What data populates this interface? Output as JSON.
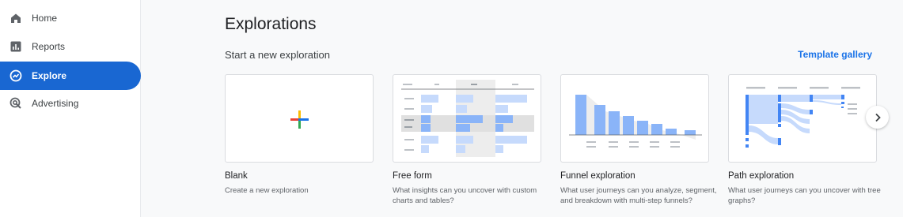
{
  "sidebar": {
    "items": [
      {
        "label": "Home",
        "icon": "home-icon",
        "active": false
      },
      {
        "label": "Reports",
        "icon": "bar-chart-icon",
        "active": false
      },
      {
        "label": "Explore",
        "icon": "explore-icon",
        "active": true
      },
      {
        "label": "Advertising",
        "icon": "advertising-icon",
        "active": false
      }
    ]
  },
  "main": {
    "title": "Explorations",
    "subtitle": "Start a new exploration",
    "template_gallery_label": "Template gallery",
    "cards": [
      {
        "title": "Blank",
        "description": "Create a new exploration"
      },
      {
        "title": "Free form",
        "description": "What insights can you uncover with custom charts and tables?"
      },
      {
        "title": "Funnel exploration",
        "description": "What user journeys can you analyze, segment, and breakdown with multi-step funnels?"
      },
      {
        "title": "Path exploration",
        "description": "What user journeys can you uncover with tree graphs?"
      }
    ],
    "next_icon": "chevron-right-icon"
  },
  "colors": {
    "accent": "#1967d2",
    "link": "#1a73e8",
    "bar_blue": "#8ab4f8",
    "bar_light": "#c6dafc"
  }
}
